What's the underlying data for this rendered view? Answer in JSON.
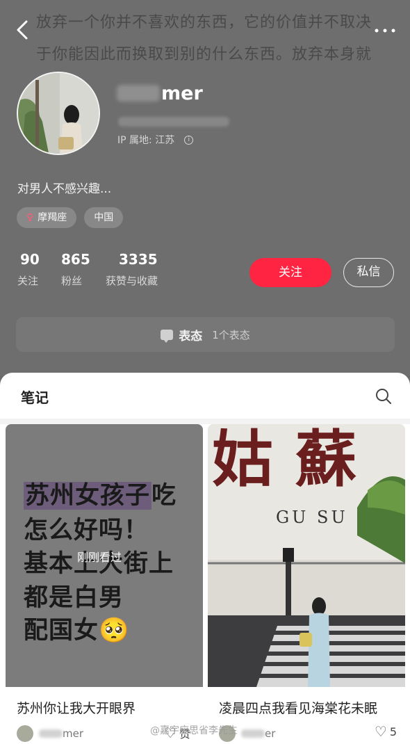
{
  "header": {
    "bg_text": "放弃一个你并不喜欢的东西，它的价值并不取决于你能因此而换取到别的什么东西。放弃本身就有价值",
    "back_label": "<",
    "more_label": "···"
  },
  "profile": {
    "username_suffix": "mer",
    "ip_location": "IP 属地: 江苏",
    "info_icon": "i",
    "bio": "对男人不感兴趣...",
    "tags": [
      {
        "label": "摩羯座",
        "icon": "female-icon"
      },
      {
        "label": "中国"
      }
    ],
    "female_symbol": "♀"
  },
  "stats": [
    {
      "value": "90",
      "label": "关注"
    },
    {
      "value": "865",
      "label": "粉丝"
    },
    {
      "value": "3335",
      "label": "获赞与收藏"
    }
  ],
  "actions": {
    "follow_label": "关注",
    "message_label": "私信",
    "follow_color": "#ff2442"
  },
  "biaotai": {
    "title": "表态",
    "count": "1个表态"
  },
  "notes": {
    "tab_label": "笔记",
    "cards": [
      {
        "cover_lines": [
          "苏州女孩子吃",
          "怎么好吗！",
          "基本上大街上",
          "都是白男",
          "配国女🥺"
        ],
        "highlight_text": "苏州女孩子",
        "seen_badge": "刚刚看过",
        "title": "苏州你让我大开眼界",
        "author_suffix": "mer",
        "likes": "赞"
      },
      {
        "cover_big_text": "姑蘇",
        "cover_sub_text": "GU SU",
        "title": "凌晨四点我看见海棠花未眠",
        "author_suffix": "er",
        "likes": "5"
      }
    ]
  },
  "watermark": "@嘉宇应思省李先生"
}
